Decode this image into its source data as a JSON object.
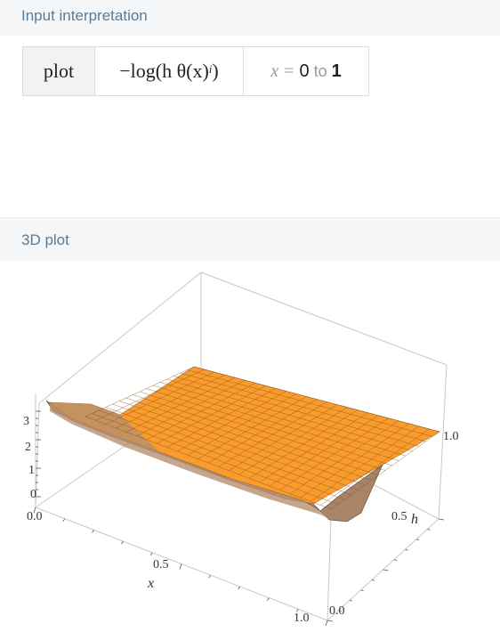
{
  "pods": [
    {
      "title": "Input interpretation"
    },
    {
      "title": "3D plot"
    }
  ],
  "input": {
    "keyword": "plot",
    "expression": "−log(h θ(x)",
    "exponent": "i",
    "expression_close": ")",
    "range_var": "x",
    "range_eq": "=",
    "range_from": "0",
    "range_to_word": "to",
    "range_to": "1"
  },
  "chart_data": {
    "type": "surface3d",
    "title": "",
    "x_label": "x",
    "h_label": "h",
    "x_ticks": [
      "0.0",
      "0.5",
      "1.0"
    ],
    "h_ticks": [
      "0.0",
      "0.5",
      "1.0"
    ],
    "z_ticks": [
      "0",
      "1",
      "2",
      "3"
    ],
    "x_range": [
      0,
      1
    ],
    "h_range": [
      0,
      1
    ],
    "surface_color": "#f7941d",
    "underside_color": "#a88468",
    "grid": true
  }
}
